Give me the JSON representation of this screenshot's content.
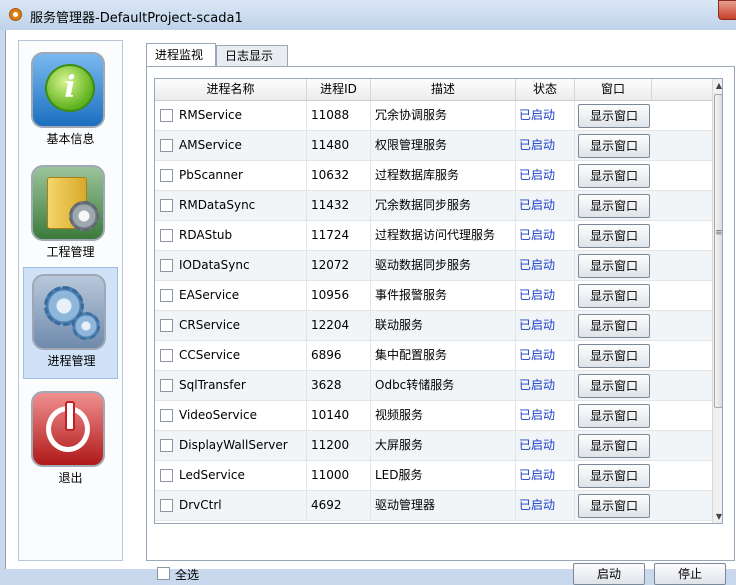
{
  "window": {
    "title": "服务管理器-DefaultProject-scada1"
  },
  "nav": {
    "items": [
      {
        "label": "基本信息",
        "icon": "info-icon"
      },
      {
        "label": "工程管理",
        "icon": "project-folder-gear-icon"
      },
      {
        "label": "进程管理",
        "icon": "process-gears-icon",
        "active": true
      },
      {
        "label": "退出",
        "icon": "power-icon"
      }
    ]
  },
  "tabs": [
    {
      "label": "进程监视",
      "active": true
    },
    {
      "label": "日志显示",
      "active": false
    }
  ],
  "table": {
    "columns": [
      "进程名称",
      "进程ID",
      "描述",
      "状态",
      "窗口"
    ],
    "rows": [
      {
        "name": "RMService",
        "pid": "11088",
        "desc": "冗余协调服务",
        "status": "已启动",
        "button": "显示窗口"
      },
      {
        "name": "AMService",
        "pid": "11480",
        "desc": "权限管理服务",
        "status": "已启动",
        "button": "显示窗口"
      },
      {
        "name": "PbScanner",
        "pid": "10632",
        "desc": "过程数据库服务",
        "status": "已启动",
        "button": "显示窗口"
      },
      {
        "name": "RMDataSync",
        "pid": "11432",
        "desc": "冗余数据同步服务",
        "status": "已启动",
        "button": "显示窗口"
      },
      {
        "name": "RDAStub",
        "pid": "11724",
        "desc": "过程数据访问代理服务",
        "status": "已启动",
        "button": "显示窗口"
      },
      {
        "name": "IODataSync",
        "pid": "12072",
        "desc": "驱动数据同步服务",
        "status": "已启动",
        "button": "显示窗口"
      },
      {
        "name": "EAService",
        "pid": "10956",
        "desc": "事件报警服务",
        "status": "已启动",
        "button": "显示窗口"
      },
      {
        "name": "CRService",
        "pid": "12204",
        "desc": "联动服务",
        "status": "已启动",
        "button": "显示窗口"
      },
      {
        "name": "CCService",
        "pid": "6896",
        "desc": "集中配置服务",
        "status": "已启动",
        "button": "显示窗口"
      },
      {
        "name": "SqlTransfer",
        "pid": "3628",
        "desc": "Odbc转储服务",
        "status": "已启动",
        "button": "显示窗口"
      },
      {
        "name": "VideoService",
        "pid": "10140",
        "desc": "视频服务",
        "status": "已启动",
        "button": "显示窗口"
      },
      {
        "name": "DisplayWallServer",
        "pid": "11200",
        "desc": "大屏服务",
        "status": "已启动",
        "button": "显示窗口"
      },
      {
        "name": "LedService",
        "pid": "11000",
        "desc": "LED服务",
        "status": "已启动",
        "button": "显示窗口"
      },
      {
        "name": "DrvCtrl",
        "pid": "4692",
        "desc": "驱动管理器",
        "status": "已启动",
        "button": "显示窗口"
      }
    ]
  },
  "footer": {
    "select_all": "全选",
    "start": "启动",
    "stop": "停止"
  },
  "colors": {
    "status_running": "#1a3ec8",
    "nav_active": "#cfe2f7"
  }
}
